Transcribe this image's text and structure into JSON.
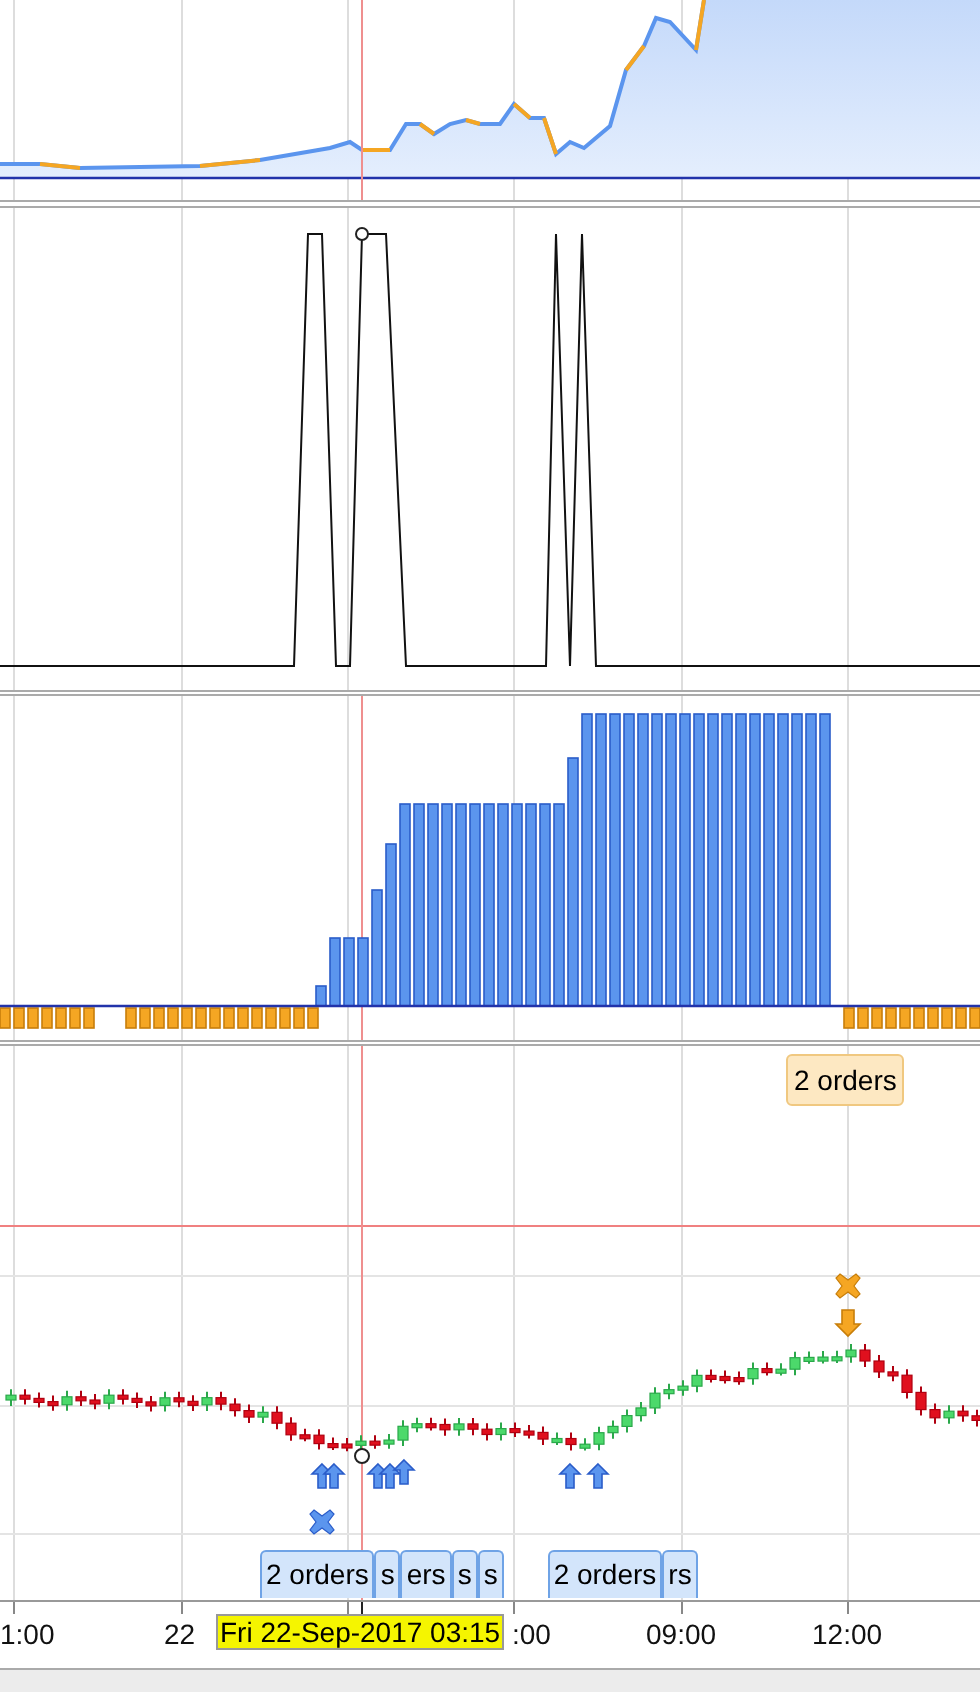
{
  "order_tags": [
    {
      "label": "2 orders",
      "color": "#fde8c2",
      "kind": "upper"
    },
    {
      "label": "2 orders",
      "color": "#d3e5fb",
      "kind": "lower"
    },
    {
      "label": "s",
      "color": "#d3e5fb",
      "kind": "lower"
    },
    {
      "label": "ers",
      "color": "#d3e5fb",
      "kind": "lower"
    },
    {
      "label": "s",
      "color": "#d3e5fb",
      "kind": "lower"
    },
    {
      "label": "s",
      "color": "#d3e5fb",
      "kind": "lower"
    },
    {
      "label": "2 orders",
      "color": "#d3e5fb",
      "kind": "lower"
    },
    {
      "label": "rs",
      "color": "#d3e5fb",
      "kind": "lower"
    }
  ],
  "x_axis": {
    "labels": [
      "1:00",
      "22",
      ":00",
      "09:00",
      "12:00"
    ],
    "cursor_label": "Fri 22-Sep-2017 03:15"
  }
}
